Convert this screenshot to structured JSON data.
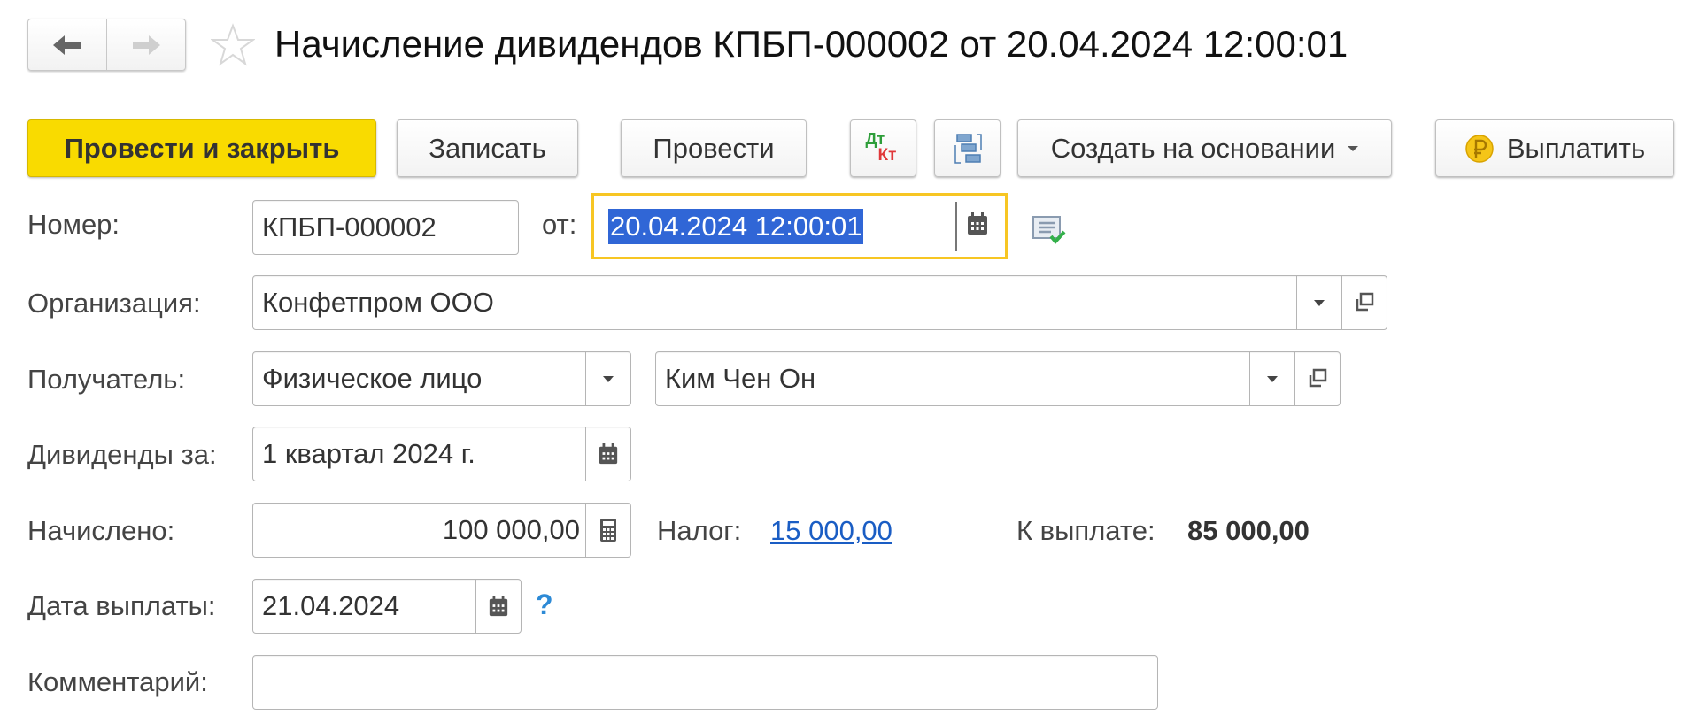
{
  "header": {
    "title": "Начисление дивидендов КПБП-000002 от 20.04.2024 12:00:01",
    "nav": {
      "back": "back-arrow",
      "forward": "forward-arrow"
    },
    "favorite_icon": "star-icon"
  },
  "toolbar": {
    "post_and_close": "Провести и закрыть",
    "save": "Записать",
    "post": "Провести",
    "dt_kt_top": "Дт",
    "dt_kt_bottom": "Кт",
    "create_based_on": "Создать на основании",
    "pay": "Выплатить",
    "colors": {
      "accent_yellow": "#f9db00",
      "dt_green": "#2e9e3a",
      "kt_red": "#e0383a"
    }
  },
  "form": {
    "number_label": "Номер:",
    "number_value": "КПБП-000002",
    "date_label": "от:",
    "date_value": "20.04.2024 12:00:01",
    "organization_label": "Организация:",
    "organization_value": "Конфетпром ООО",
    "recipient_label": "Получатель:",
    "recipient_type": "Физическое лицо",
    "recipient_value": "Ким Чен Он",
    "dividends_for_label": "Дивиденды за:",
    "dividends_for_value": "1 квартал 2024 г.",
    "accrued_label": "Начислено:",
    "accrued_value": "100 000,00",
    "tax_label": "Налог:",
    "tax_value": "15 000,00",
    "to_pay_label": "К выплате:",
    "to_pay_value": "85 000,00",
    "pay_date_label": "Дата выплаты:",
    "pay_date_value": "21.04.2024",
    "help_mark": "?",
    "comment_label": "Комментарий:",
    "comment_value": ""
  }
}
